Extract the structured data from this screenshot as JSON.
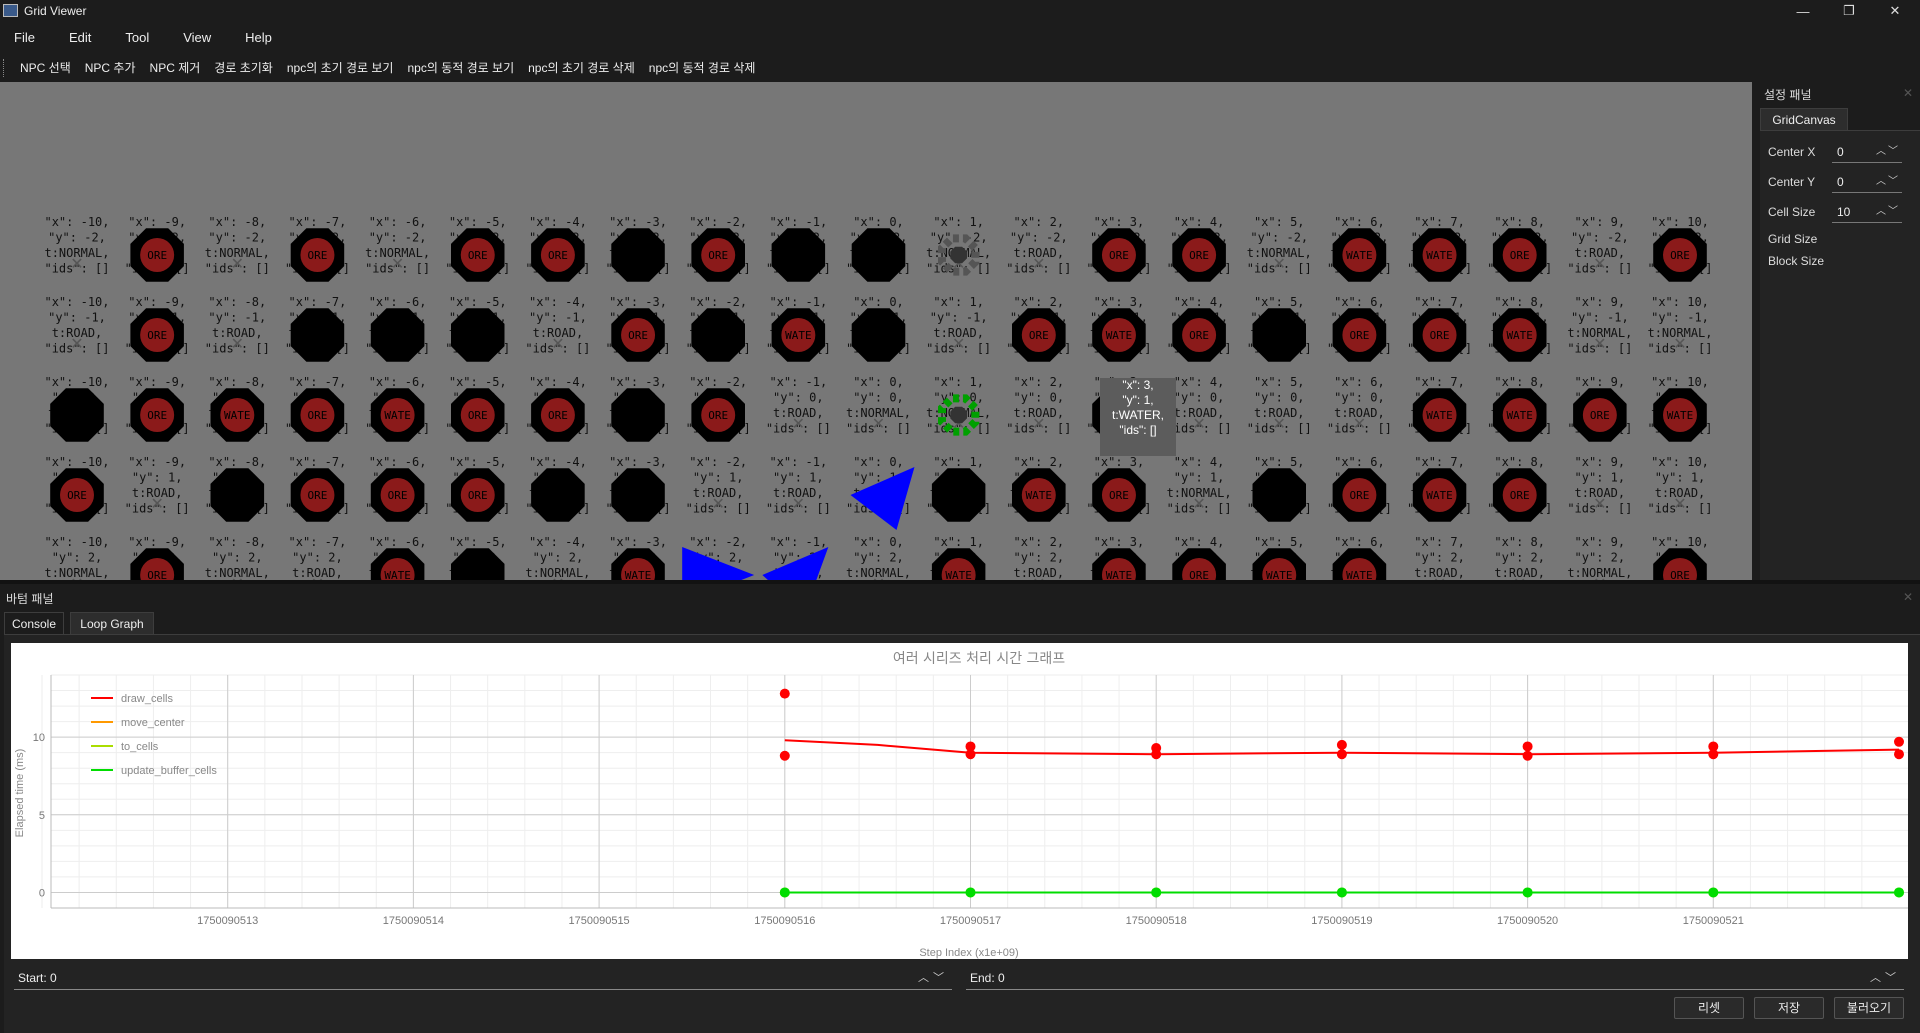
{
  "window": {
    "title": "Grid Viewer",
    "controls": [
      "—",
      "❐",
      "✕"
    ]
  },
  "menu": [
    "File",
    "Edit",
    "Tool",
    "View",
    "Help"
  ],
  "toolbar": [
    "NPC 선택",
    "NPC 추가",
    "NPC 제거",
    "경로 초기화",
    "npc의 초기 경로 보기",
    "npc의 동적 경로 보기",
    "npc의 초기 경로 삭제",
    "npc의 동적 경로 삭제"
  ],
  "grid": {
    "background": "#777777",
    "x_values": [
      -10,
      -9,
      -8,
      -7,
      -6,
      -5,
      -4,
      -3,
      -2,
      -1,
      0,
      1,
      2,
      3,
      4,
      5,
      6,
      7,
      8,
      9,
      10
    ],
    "y_values": [
      -2,
      -1,
      0,
      1,
      2
    ],
    "cell_lines": [
      "\"x\": {x},",
      "\"y\": {y},",
      "t:{t},",
      "\"ids\": []"
    ],
    "terrain_codes": [
      "NORMAL",
      "ROAD",
      "ORE",
      "WATER",
      "BLOCK"
    ],
    "colors": {
      "block": "#000000",
      "ore": "#8b1a1a",
      "water": "#8b1a1a",
      "npc": "#0000ff",
      "goal": "#00a000"
    },
    "rows": [
      [
        "NORMAL",
        "ORE",
        "NORMAL",
        "ORE",
        "NORMAL",
        "ORE",
        "ORE",
        "BLOCK",
        "ORE",
        "BLOCK",
        "BLOCK",
        "GOAL_GRAY",
        "ROAD",
        "ORE",
        "ORE",
        "NORMAL",
        "WATER",
        "WATER",
        "ORE",
        "ROAD",
        "ORE"
      ],
      [
        "ROAD",
        "ORE",
        "ROAD",
        "BLOCK",
        "BLOCK",
        "BLOCK",
        "ROAD",
        "ORE",
        "BLOCK",
        "WATER",
        "BLOCK",
        "ROAD",
        "ORE",
        "WATER",
        "ORE",
        "BLOCK",
        "ORE",
        "ORE",
        "WATER",
        "NORMAL",
        "NORMAL"
      ],
      [
        "BLOCK",
        "ORE",
        "WATER",
        "ORE",
        "WATER",
        "ORE",
        "ORE",
        "BLOCK",
        "ORE",
        "ROAD",
        "NORMAL",
        "GOAL",
        "ROAD",
        "ORE",
        "ROAD",
        "ROAD",
        "ROAD",
        "WATER",
        "WATER",
        "ORE",
        "WATER"
      ],
      [
        "ORE",
        "ROAD",
        "BLOCK",
        "ORE",
        "ORE",
        "ORE",
        "BLOCK",
        "BLOCK",
        "ROAD",
        "ROAD",
        "NPC",
        "BLOCK",
        "WATER",
        "ORE",
        "NORMAL",
        "BLOCK",
        "ORE",
        "WATER",
        "ORE",
        "ROAD",
        "ROAD"
      ],
      [
        "NORMAL",
        "ORE",
        "NORMAL",
        "ROAD",
        "WATER",
        "BLOCK",
        "NORMAL",
        "WATER",
        "NPC",
        "NPC",
        "NORMAL",
        "WATER",
        "ROAD",
        "WATER",
        "ORE",
        "WATER",
        "WATER",
        "ROAD",
        "ROAD",
        "NORMAL",
        "ORE"
      ]
    ],
    "tooltip": [
      "\"x\": 3,",
      "\"y\": 1,",
      "t:WATER,",
      "\"ids\": []"
    ]
  },
  "settings_panel": {
    "title": "설정 패널",
    "tab": "GridCanvas",
    "fields": [
      {
        "label": "Center X",
        "value": "0"
      },
      {
        "label": "Center Y",
        "value": "0"
      },
      {
        "label": "Cell Size",
        "value": "10"
      }
    ],
    "labels": [
      "Grid Size",
      "Block Size"
    ]
  },
  "bottom_panel": {
    "title": "바텀 패널",
    "tabs": [
      "Console",
      "Loop Graph"
    ],
    "start_label": "Start: 0",
    "end_label": "End: 0",
    "buttons": [
      "리셋",
      "저장",
      "불러오기"
    ]
  },
  "chart_data": {
    "type": "line",
    "title": "여러 시리즈 처리 시간 그래프",
    "xlabel": "Step Index (x1e+09)",
    "ylabel": "Elapsed time (ms)",
    "xlim": [
      1750090512.0,
      1750090522.0
    ],
    "ylim": [
      -1.0,
      14.0
    ],
    "x_ticks": [
      1750090513,
      1750090514,
      1750090515,
      1750090516,
      1750090517,
      1750090518,
      1750090519,
      1750090520,
      1750090521
    ],
    "y_ticks": [
      0,
      5,
      10
    ],
    "grid": true,
    "legend_placement": "top-left",
    "series": [
      {
        "name": "draw_cells",
        "color": "#ff0000",
        "x": [
          1750090516,
          1750090516,
          1750090517,
          1750090517,
          1750090518,
          1750090518,
          1750090519,
          1750090519,
          1750090520,
          1750090520,
          1750090521,
          1750090521,
          1750090522,
          1750090522
        ],
        "y": [
          12.8,
          8.8,
          9.4,
          8.9,
          9.3,
          8.9,
          9.5,
          8.9,
          9.4,
          8.8,
          9.4,
          8.9,
          9.7,
          8.9
        ],
        "line_x": [
          1750090516,
          1750090516.5,
          1750090517,
          1750090518,
          1750090519,
          1750090520,
          1750090521,
          1750090522
        ],
        "line_y": [
          9.8,
          9.5,
          9.0,
          8.9,
          9.0,
          8.9,
          9.0,
          9.2
        ]
      },
      {
        "name": "move_center",
        "color": "#ff9900",
        "x": [],
        "y": []
      },
      {
        "name": "to_cells",
        "color": "#aadd00",
        "x": [
          1750090516,
          1750090517,
          1750090518,
          1750090519,
          1750090520,
          1750090521,
          1750090522
        ],
        "y": [
          0,
          0,
          0,
          0,
          0,
          0,
          0
        ]
      },
      {
        "name": "update_buffer_cells",
        "color": "#00dd00",
        "x": [
          1750090516,
          1750090517,
          1750090518,
          1750090519,
          1750090520,
          1750090521,
          1750090522
        ],
        "y": [
          0,
          0,
          0,
          0,
          0,
          0,
          0
        ]
      }
    ]
  }
}
